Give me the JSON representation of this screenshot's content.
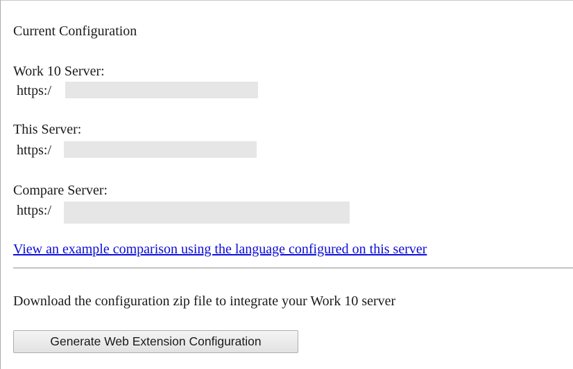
{
  "heading": "Current Configuration",
  "servers": [
    {
      "label": "Work 10 Server:",
      "url_prefix": "https:/"
    },
    {
      "label": "This Server:",
      "url_prefix": "https:/"
    },
    {
      "label": "Compare Server:",
      "url_prefix": "https:/"
    }
  ],
  "example_link": "View an example comparison using the language configured on this server",
  "download_text": "Download the configuration zip file to integrate your Work 10 server",
  "generate_button": "Generate Web Extension Configuration"
}
